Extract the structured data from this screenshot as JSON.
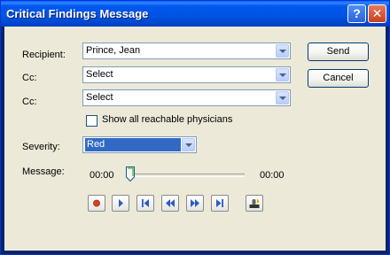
{
  "window": {
    "title": "Critical Findings Message"
  },
  "form": {
    "recipient_label": "Recipient:",
    "recipient_value": "Prince, Jean",
    "cc1_label": "Cc:",
    "cc1_value": "Select",
    "cc2_label": "Cc:",
    "cc2_value": "Select",
    "show_all_label": "Show all reachable physicians",
    "show_all_checked": false,
    "severity_label": "Severity:",
    "severity_value": "Red",
    "message_label": "Message:"
  },
  "buttons": {
    "send": "Send",
    "cancel": "Cancel"
  },
  "player": {
    "start_time": "00:00",
    "end_time": "00:00",
    "position": 0,
    "controls": [
      "record-icon",
      "play-icon",
      "skip-start-icon",
      "rewind-icon",
      "fast-forward-icon",
      "skip-end-icon",
      "mic-settings-icon"
    ]
  },
  "colors": {
    "title_bar": "#0054e3",
    "severity_bg": "#316ac5",
    "record": "#e0401f",
    "control_icon": "#2c5bc7"
  }
}
